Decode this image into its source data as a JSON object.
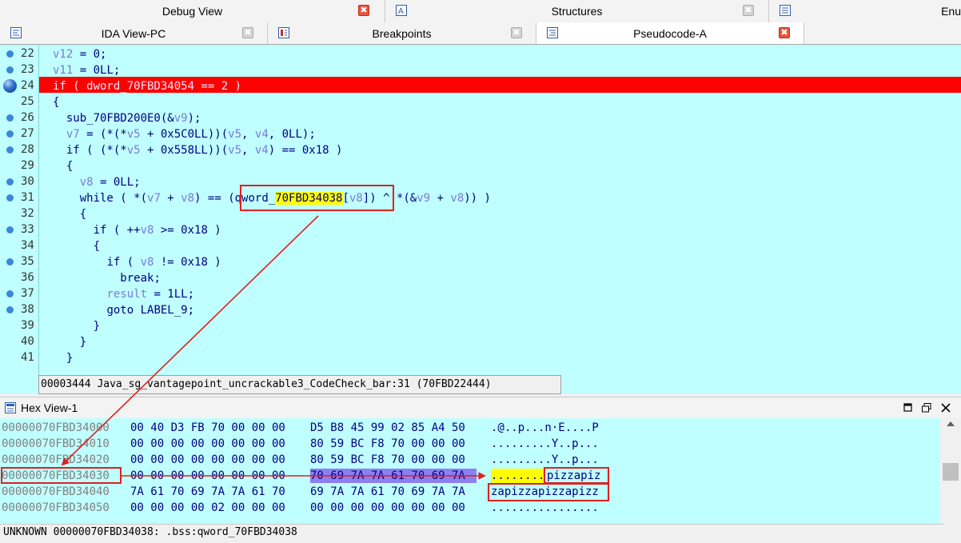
{
  "tabs_top": [
    {
      "label": "Debug View",
      "icon": "debug-icon"
    },
    {
      "label": "Structures",
      "icon": "structures-icon"
    },
    {
      "label": "Enu",
      "icon": "enums-icon"
    }
  ],
  "tabs_second": [
    {
      "label": "IDA View-PC",
      "icon": "ida-view-icon"
    },
    {
      "label": "Breakpoints",
      "icon": "breakpoints-icon"
    },
    {
      "label": "Pseudocode-A",
      "icon": "pseudocode-icon"
    }
  ],
  "close_glyph": "✖",
  "code": {
    "line_numbers": [
      "22",
      "23",
      "24",
      "25",
      "26",
      "27",
      "28",
      "29",
      "30",
      "31",
      "32",
      "33",
      "34",
      "35",
      "36",
      "37",
      "38",
      "39",
      "40",
      "41"
    ],
    "lines": [
      {
        "indent": "",
        "parts": [
          "v12",
          " = 0;"
        ]
      },
      {
        "indent": "",
        "parts": [
          "v11",
          " = 0LL;"
        ]
      },
      {
        "indent": "",
        "parts": [
          "if ( dword_70FBD34054 == 2 )"
        ]
      },
      {
        "indent": "",
        "parts": [
          "{"
        ]
      },
      {
        "indent": "  ",
        "parts": [
          "sub_70FBD200E0(&",
          "v9",
          ");"
        ]
      },
      {
        "indent": "  ",
        "parts": [
          "v7",
          " = (*(*",
          "v5",
          " + 0x5C0LL))(",
          "v5",
          ", ",
          "v4",
          ", 0LL);"
        ]
      },
      {
        "indent": "  ",
        "parts": [
          "if ( (*(*",
          "v5",
          " + 0x558LL))(",
          "v5",
          ", ",
          "v4",
          ") == 0x18 )"
        ]
      },
      {
        "indent": "  ",
        "parts": [
          "{"
        ]
      },
      {
        "indent": "    ",
        "parts": [
          "v8",
          " = 0LL;"
        ]
      },
      {
        "indent": "    ",
        "parts": [
          "while ( *(",
          "v7",
          " + ",
          "v8",
          ") == ",
          "(qword_",
          "70FBD34038",
          "[",
          "v8",
          "])",
          " ^ *(&",
          "v9",
          " + ",
          "v8",
          ")) )"
        ]
      },
      {
        "indent": "    ",
        "parts": [
          "{"
        ]
      },
      {
        "indent": "      ",
        "parts": [
          "if ( ++",
          "v8",
          " >= 0x18 )"
        ]
      },
      {
        "indent": "      ",
        "parts": [
          "{"
        ]
      },
      {
        "indent": "        ",
        "parts": [
          "if ( ",
          "v8",
          " != 0x18 )"
        ]
      },
      {
        "indent": "          ",
        "parts": [
          "break;"
        ]
      },
      {
        "indent": "        ",
        "parts": [
          "result",
          " = 1LL;"
        ]
      },
      {
        "indent": "        ",
        "parts": [
          "goto LABEL_9;"
        ]
      },
      {
        "indent": "      ",
        "parts": [
          "}"
        ]
      },
      {
        "indent": "    ",
        "parts": [
          "}"
        ]
      },
      {
        "indent": "  ",
        "parts": [
          "}"
        ]
      }
    ],
    "status": "00003444 Java_sg_vantagepoint_uncrackable3_CodeCheck_bar:31 (70FBD22444)"
  },
  "hex_view": {
    "title": "Hex View-1",
    "rows": [
      {
        "addr": "00000070FBD34000",
        "b1": "00 40 D3 FB 70 00 00 00",
        "b2": "D5 B8 45 99 02 85 A4 50",
        "ascii": ".@..p...n·E....P"
      },
      {
        "addr": "00000070FBD34010",
        "b1": "00 00 00 00 00 00 00 00",
        "b2": "80 59 BC F8 70 00 00 00",
        "ascii": ".........Y..p..."
      },
      {
        "addr": "00000070FBD34020",
        "b1": "00 00 00 00 00 00 00 00",
        "b2": "80 59 BC F8 70 00 00 00",
        "ascii": ".........Y..p..."
      },
      {
        "addr": "00000070FBD34030",
        "b1": "00 00 00 00 00 00 00 00",
        "b2": "70 69 7A 7A 61 70 69 7A",
        "ascii": "........",
        "ascii2": "pizzapiz"
      },
      {
        "addr": "00000070FBD34040",
        "b1": "7A 61 70 69 7A 7A 61 70",
        "b2": "69 7A 7A 61 70 69 7A 7A",
        "ascii": "zapizzapizzapizz"
      },
      {
        "addr": "00000070FBD34050",
        "b1": "00 00 00 00 02 00 00 00",
        "b2": "00 00 00 00 00 00 00 00",
        "ascii": "................"
      }
    ],
    "status": "UNKNOWN 00000070FBD34038: .bss:qword_70FBD34038"
  },
  "colors": {
    "code_bg": "#c0ffff",
    "highlight_red": "#ff0000",
    "annotation_red": "#e02020",
    "selection_purple": "#8c7ff0",
    "yellow": "#ffff00"
  }
}
